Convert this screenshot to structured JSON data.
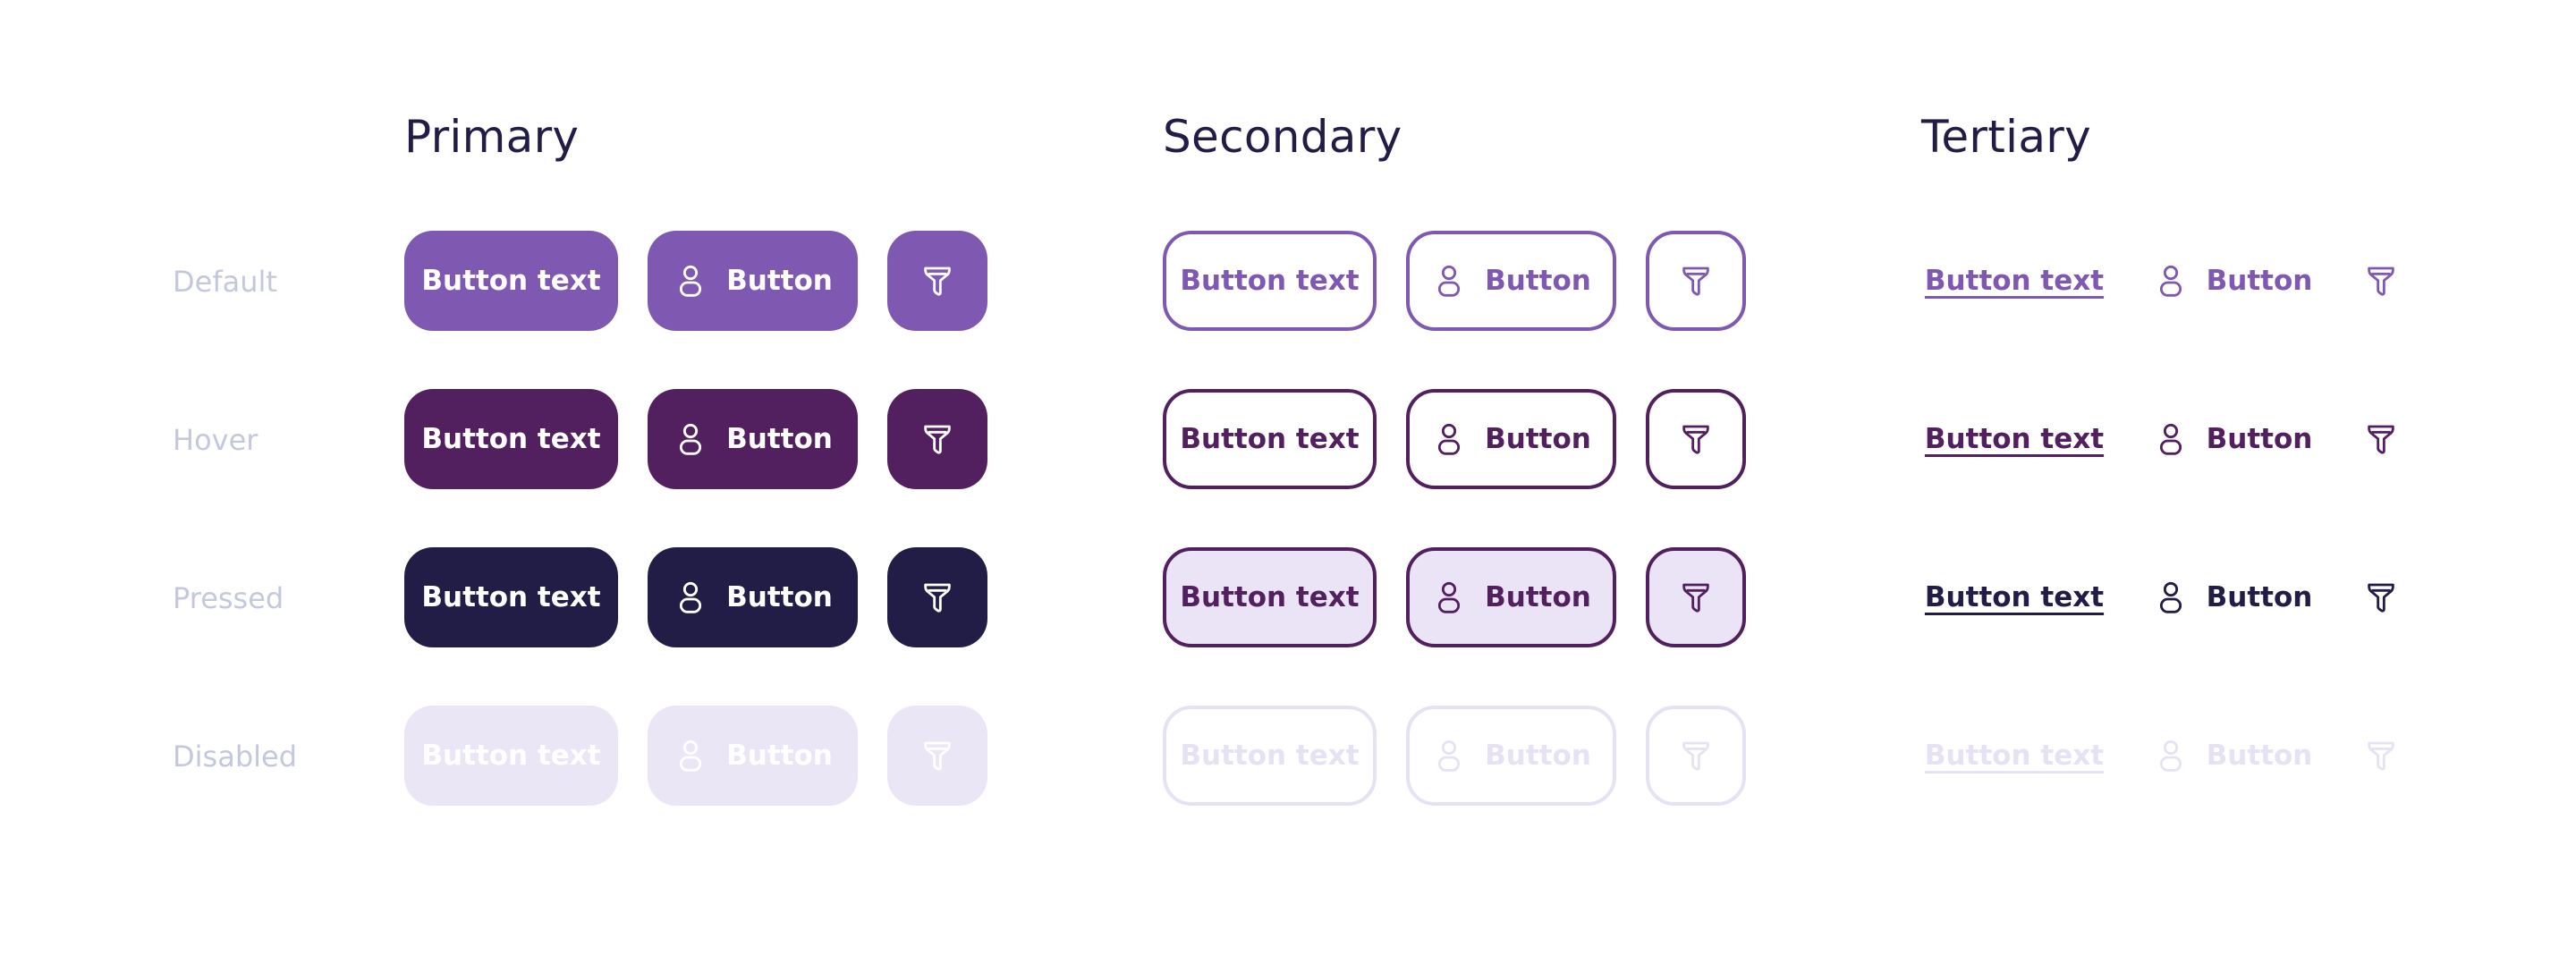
{
  "columns": {
    "primary": "Primary",
    "secondary": "Secondary",
    "tertiary": "Tertiary"
  },
  "states": {
    "default": "Default",
    "hover": "Hover",
    "pressed": "Pressed",
    "disabled": "Disabled"
  },
  "buttons": {
    "text_label": "Button text",
    "short_label": "Button"
  },
  "icons": {
    "person": "person-icon",
    "filter": "filter-icon"
  },
  "colors": {
    "default": "#7e58b1",
    "hover": "#52205f",
    "pressed": "#221d47",
    "disabled_fill": "#ebe6f6",
    "disabled_fg": "#ffffff",
    "disabled_outline": "#e6e2f4",
    "pressed_secondary_fill": "#ebe4f6",
    "background": "#ffffff",
    "title_text": "#221d47",
    "state_label": "#c3c8dc"
  }
}
